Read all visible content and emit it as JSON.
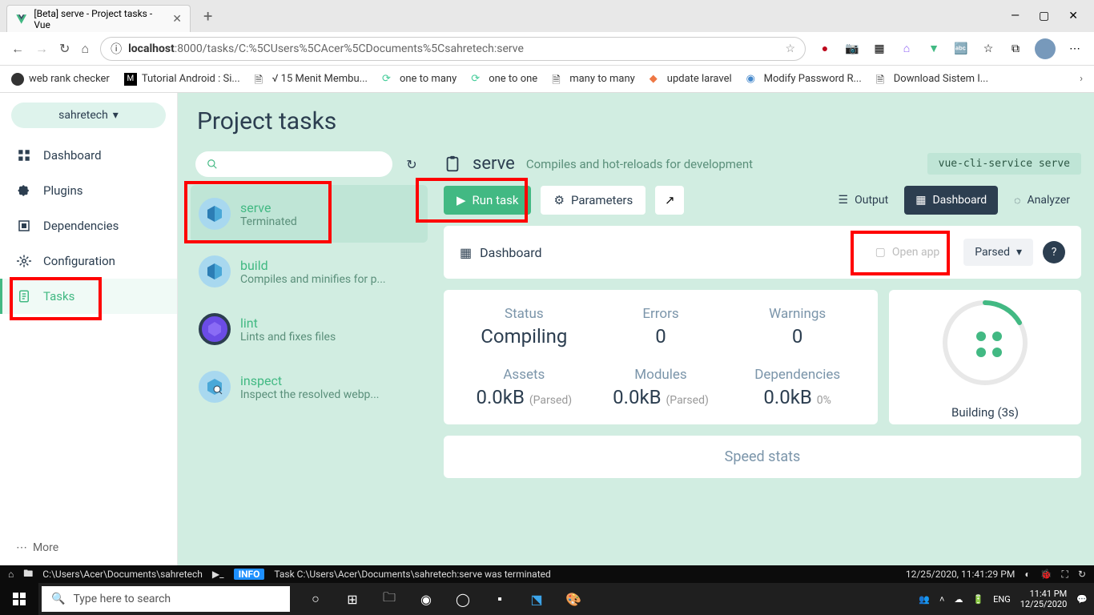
{
  "browser": {
    "tab_title": "[Beta] serve - Project tasks - Vue",
    "url_host": "localhost",
    "url_path": ":8000/tasks/C:%5CUsers%5CAcer%5CDocuments%5Csahretech:serve",
    "bookmarks": [
      "web rank checker",
      "Tutorial Android : Si...",
      "√ 15 Menit Membu...",
      "one to many",
      "one to one",
      "many to many",
      "update laravel",
      "Modify Password R...",
      "Download Sistem I..."
    ]
  },
  "sidebar": {
    "project_name": "sahretech",
    "items": [
      "Dashboard",
      "Plugins",
      "Dependencies",
      "Configuration",
      "Tasks"
    ],
    "more": "More"
  },
  "page": {
    "title": "Project tasks"
  },
  "tasks": [
    {
      "name": "serve",
      "desc": "Terminated"
    },
    {
      "name": "build",
      "desc": "Compiles and minifies for p..."
    },
    {
      "name": "lint",
      "desc": "Lints and fixes files"
    },
    {
      "name": "inspect",
      "desc": "Inspect the resolved webp..."
    }
  ],
  "detail": {
    "name": "serve",
    "desc": "Compiles and hot-reloads for development",
    "script": "vue-cli-service serve",
    "run_label": "Run task",
    "parameters_label": "Parameters",
    "views": {
      "output": "Output",
      "dashboard": "Dashboard",
      "analyzer": "Analyzer"
    },
    "dashboard_label": "Dashboard",
    "open_app": "Open app",
    "parsed": "Parsed",
    "stats": {
      "status": {
        "label": "Status",
        "value": "Compiling"
      },
      "errors": {
        "label": "Errors",
        "value": "0"
      },
      "warnings": {
        "label": "Warnings",
        "value": "0"
      },
      "assets": {
        "label": "Assets",
        "value": "0.0kB",
        "sub": "(Parsed)"
      },
      "modules": {
        "label": "Modules",
        "value": "0.0kB",
        "sub": "(Parsed)"
      },
      "deps": {
        "label": "Dependencies",
        "value": "0.0kB",
        "sub": "0%"
      }
    },
    "building": "Building (3s)",
    "speed": "Speed stats"
  },
  "terminal": {
    "path": "C:\\Users\\Acer\\Documents\\sahretech",
    "badge": "INFO",
    "message": "Task C:\\Users\\Acer\\Documents\\sahretech:serve was terminated",
    "timestamp": "12/25/2020, 11:41:29 PM"
  },
  "taskbar": {
    "search_placeholder": "Type here to search",
    "lang": "ENG",
    "time": "11:41 PM",
    "date": "12/25/2020"
  }
}
